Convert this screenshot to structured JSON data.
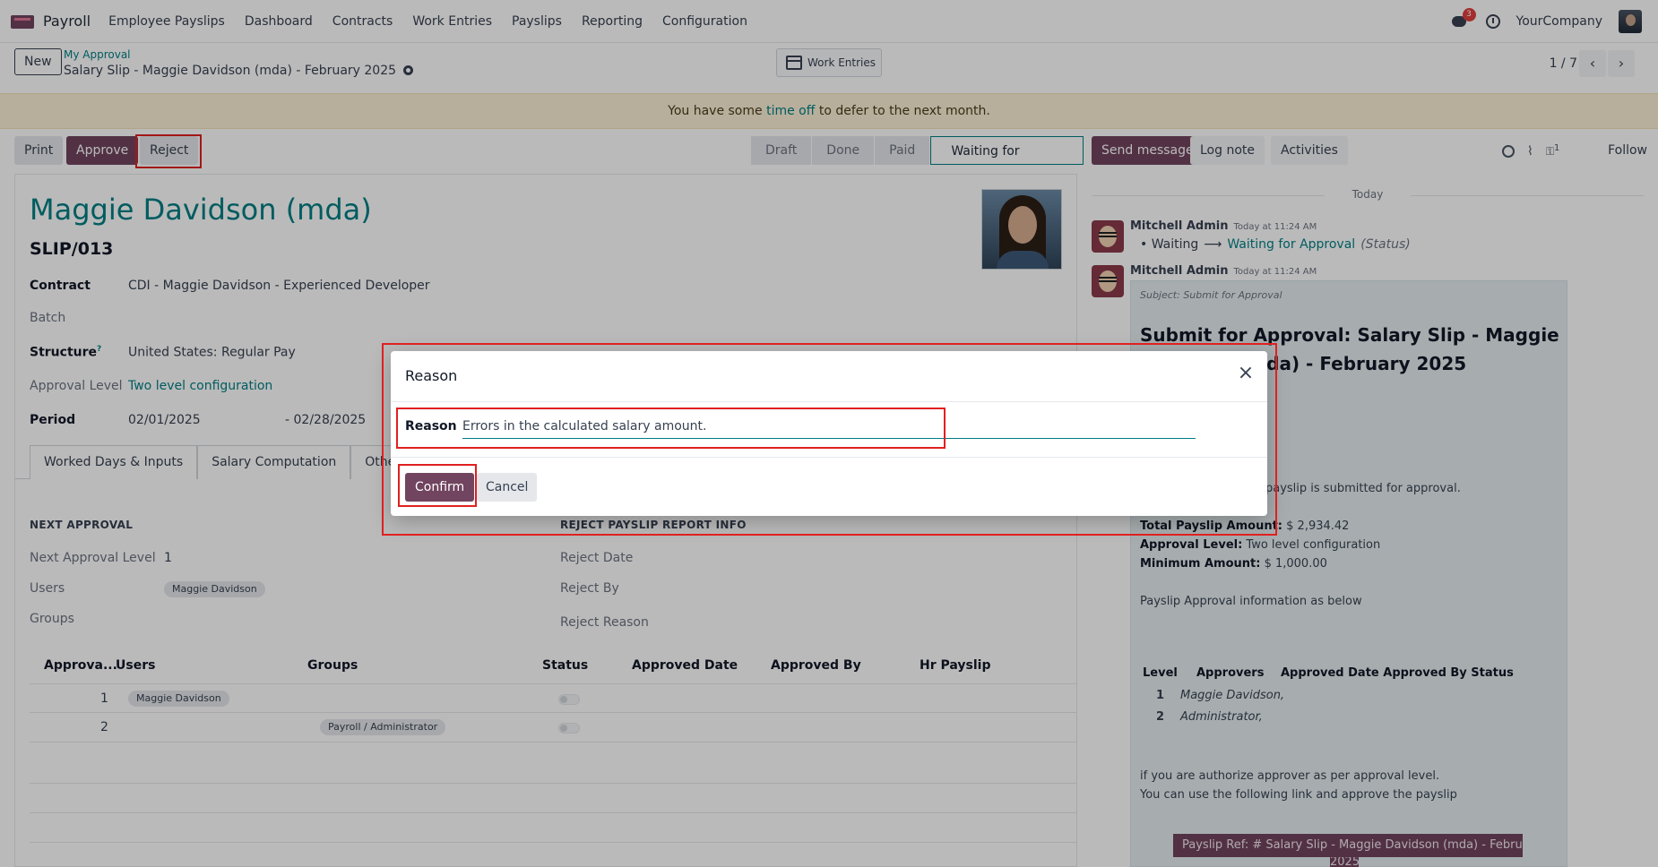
{
  "nav": {
    "app_name": "Payroll",
    "items": [
      "Employee Payslips",
      "Dashboard",
      "Contracts",
      "Work Entries",
      "Payslips",
      "Reporting",
      "Configuration"
    ],
    "chat_badge": "3",
    "company": "YourCompany"
  },
  "control": {
    "new_label": "New",
    "breadcrumb_parent": "My Approval",
    "breadcrumb_current": "Salary Slip - Maggie Davidson (mda) - February 2025",
    "work_entries_label": "Work Entries",
    "pager": "1 / 7"
  },
  "alert": {
    "before": "You have some ",
    "link": "time off",
    "after": " to defer to the next month."
  },
  "statusbar": {
    "print": "Print",
    "approve": "Approve",
    "reject": "Reject",
    "stages": [
      "Draft",
      "Done",
      "Paid",
      "Waiting for Approval"
    ]
  },
  "chatter_actions": {
    "send_message": "Send message",
    "log_note": "Log note",
    "activities": "Activities",
    "followers_count": "1",
    "follow": "Follow"
  },
  "form": {
    "employee_name": "Maggie Davidson (mda)",
    "slip_number": "SLIP/013",
    "fields": [
      {
        "label": "Contract",
        "value": "CDI - Maggie Davidson - Experienced Developer"
      },
      {
        "label": "Batch",
        "value": ""
      },
      {
        "label": "Structure",
        "value": "United States: Regular Pay",
        "help": "?"
      },
      {
        "label": "Approval Level",
        "value": "Two level configuration"
      },
      {
        "label": "Period",
        "value": "02/01/2025",
        "value2": "- 02/28/2025"
      }
    ],
    "tabs": [
      "Worked Days & Inputs",
      "Salary Computation",
      "Other Info"
    ],
    "next_approval_title": "NEXT APPROVAL",
    "next_approval_level_label": "Next Approval Level",
    "next_approval_level": "1",
    "users_label": "Users",
    "users_value": "Maggie Davidson",
    "groups_label": "Groups",
    "reject_title": "REJECT PAYSLIP REPORT INFO",
    "reject_date_label": "Reject Date",
    "reject_by_label": "Reject By",
    "reject_reason_label": "Reject Reason",
    "table_headers": [
      "Approva...",
      "Users",
      "Groups",
      "Status",
      "Approved Date",
      "Approved By",
      "Hr Payslip"
    ],
    "rows": [
      {
        "level": "1",
        "user": "Maggie Davidson",
        "group": ""
      },
      {
        "level": "2",
        "user": "",
        "group": "Payroll / Administrator"
      }
    ]
  },
  "chatter": {
    "day": "Today",
    "messages": [
      {
        "author": "Mitchell Admin",
        "time": "Today at 11:24 AM",
        "old": "Waiting",
        "new": "Waiting for Approval",
        "field": "(Status)"
      },
      {
        "author": "Mitchell Admin",
        "time": "Today at 11:24 AM"
      }
    ],
    "mail": {
      "subject": "Subject: Submit for Approval",
      "title_line1": "Submit for Approval: Salary Slip - Maggie",
      "title_line2": "Davidson (mda) - February 2025",
      "submitted_text": "payslip is submitted for approval.",
      "total_label": "Total Payslip Amount:",
      "total_value": " $ 2,934.42",
      "level_label": "Approval Level:",
      "level_value": " Two level configuration",
      "min_label": "Minimum Amount:",
      "min_value": " $ 1,000.00",
      "info": "Payslip Approval information as below",
      "table_headers": [
        "Level",
        "Approvers",
        "Approved Date Approved By Status"
      ],
      "rows": [
        {
          "level": "1",
          "approver": "Maggie Davidson,"
        },
        {
          "level": "2",
          "approver": "Administrator,"
        }
      ],
      "footer1": "if you are authorize approver as per approval level.",
      "footer2": "You can use the following link and approve the payslip",
      "ref_button": "Payslip Ref: # Salary Slip - Maggie Davidson (mda) - February",
      "ref_button_wrap": "2025"
    }
  },
  "modal": {
    "title": "Reason",
    "reason_label": "Reason",
    "reason_value": "Errors in the calculated salary amount.",
    "confirm": "Confirm",
    "cancel": "Cancel"
  },
  "colors": {
    "primary": "#71445f",
    "link": "#017e84",
    "highlight": "#e02020",
    "alert_bg": "#fbf0d6"
  }
}
